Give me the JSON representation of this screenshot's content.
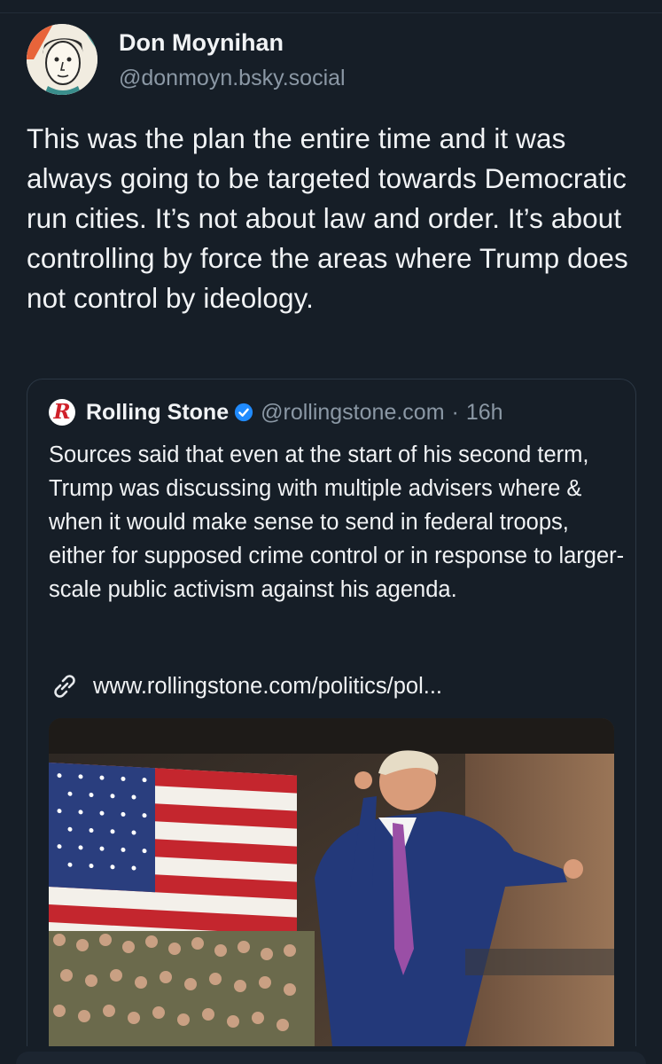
{
  "post": {
    "author": {
      "display_name": "Don Moynihan",
      "handle": "@donmoyn.bsky.social",
      "avatar_icon": "cartoon-face-avatar"
    },
    "text": "This was the plan the entire time and it was always going to be targeted towards Democratic run cities. It’s not about law and order. It’s about controlling by force the areas where Trump does not control by ideology."
  },
  "quote": {
    "author": {
      "display_name": "Rolling Stone",
      "logo_letter": "R",
      "verified": true,
      "handle": "@rollingstone.com",
      "separator": "·",
      "time": "16h"
    },
    "text": "Sources said that even at the start of his second term, Trump was discussing with multiple advisers where & when it would make sense to send in federal troops, either for supposed crime control or in response to larger-scale public activism against his agenda.",
    "link": {
      "icon": "link-icon",
      "url_text": "www.rollingstone.com/politics/pol..."
    },
    "image": {
      "subject": "man in blue suit dancing in front of American flag and seated troops"
    }
  },
  "colors": {
    "background": "#161e27",
    "text_primary": "#f1f3f5",
    "text_secondary": "#8b98a5",
    "verified_blue": "#208bfe",
    "card_border": "#2b3744"
  }
}
